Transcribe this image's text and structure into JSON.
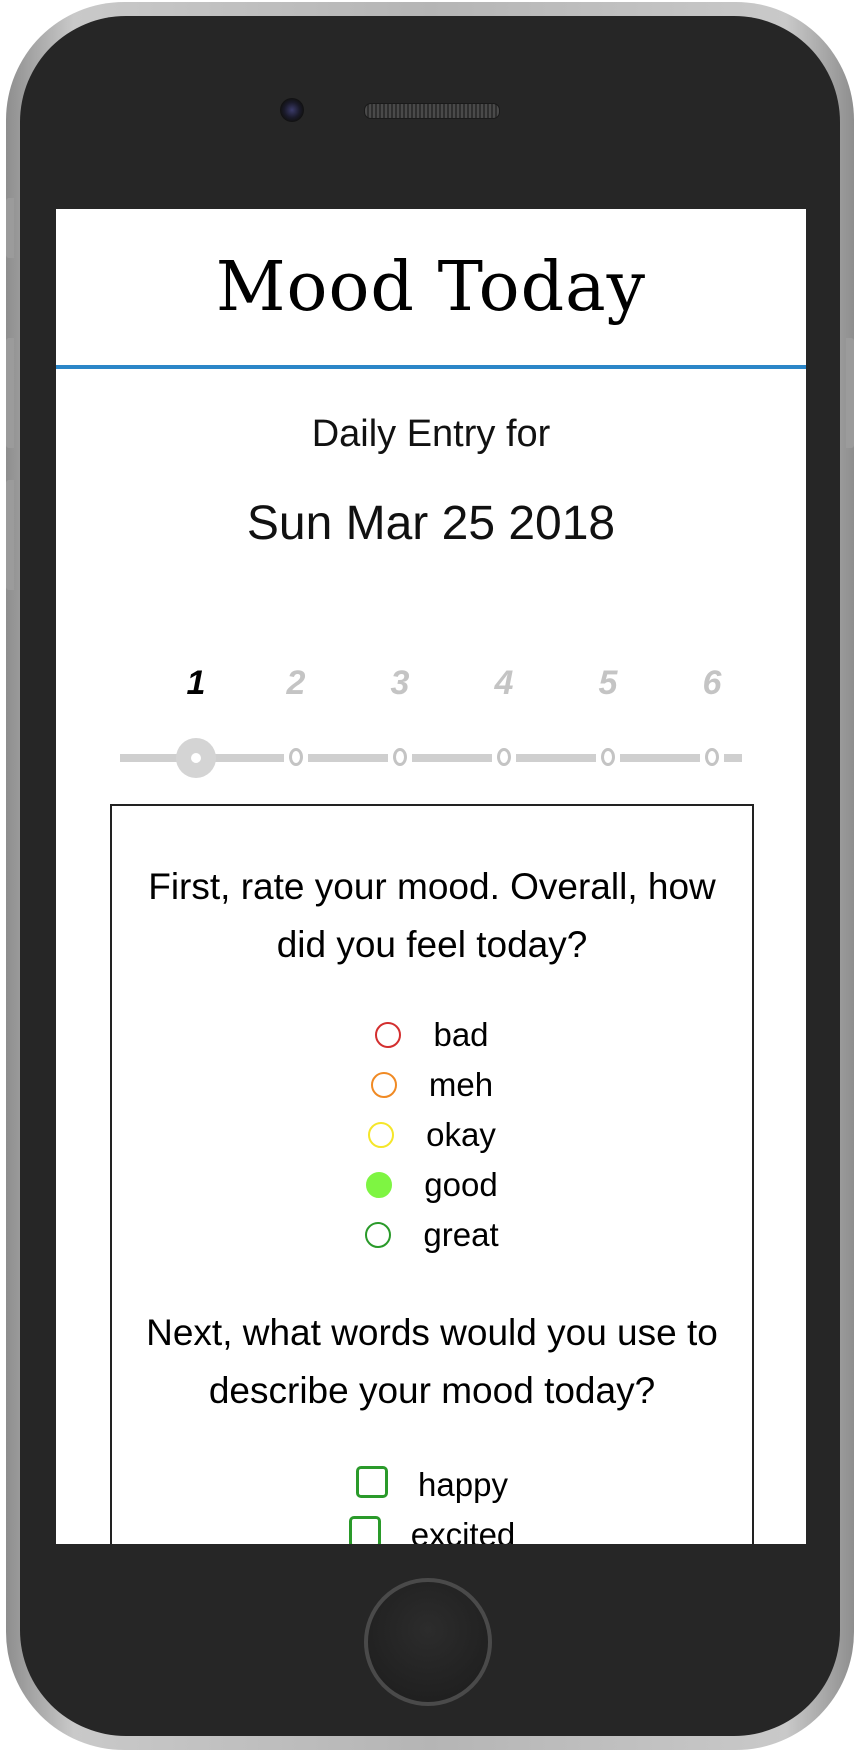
{
  "app": {
    "title": "Mood Today"
  },
  "entry": {
    "label": "Daily Entry for",
    "date": "Sun Mar 25 2018"
  },
  "stepper": {
    "current_step": 1,
    "steps": [
      "1",
      "2",
      "3",
      "4",
      "5",
      "6"
    ],
    "dot_label": "O"
  },
  "rating": {
    "question": "First, rate your mood. Overall, how did you feel today?",
    "options": [
      {
        "label": "bad",
        "color": "#d32f2f",
        "selected": false
      },
      {
        "label": "meh",
        "color": "#f08a24",
        "selected": false
      },
      {
        "label": "okay",
        "color": "#f5e62a",
        "selected": false
      },
      {
        "label": "good",
        "color": "#7ef542",
        "selected": true
      },
      {
        "label": "great",
        "color": "#2a9a2a",
        "selected": false
      }
    ]
  },
  "words": {
    "question": "Next, what words would you use to describe your mood today?",
    "options": [
      {
        "label": "happy",
        "color": "#2a9a2a",
        "checked": false
      },
      {
        "label": "excited",
        "color": "#2a9a2a",
        "checked": false
      }
    ]
  },
  "colors": {
    "accent": "#2b86c8",
    "stepper_inactive": "#c4c4c4"
  }
}
